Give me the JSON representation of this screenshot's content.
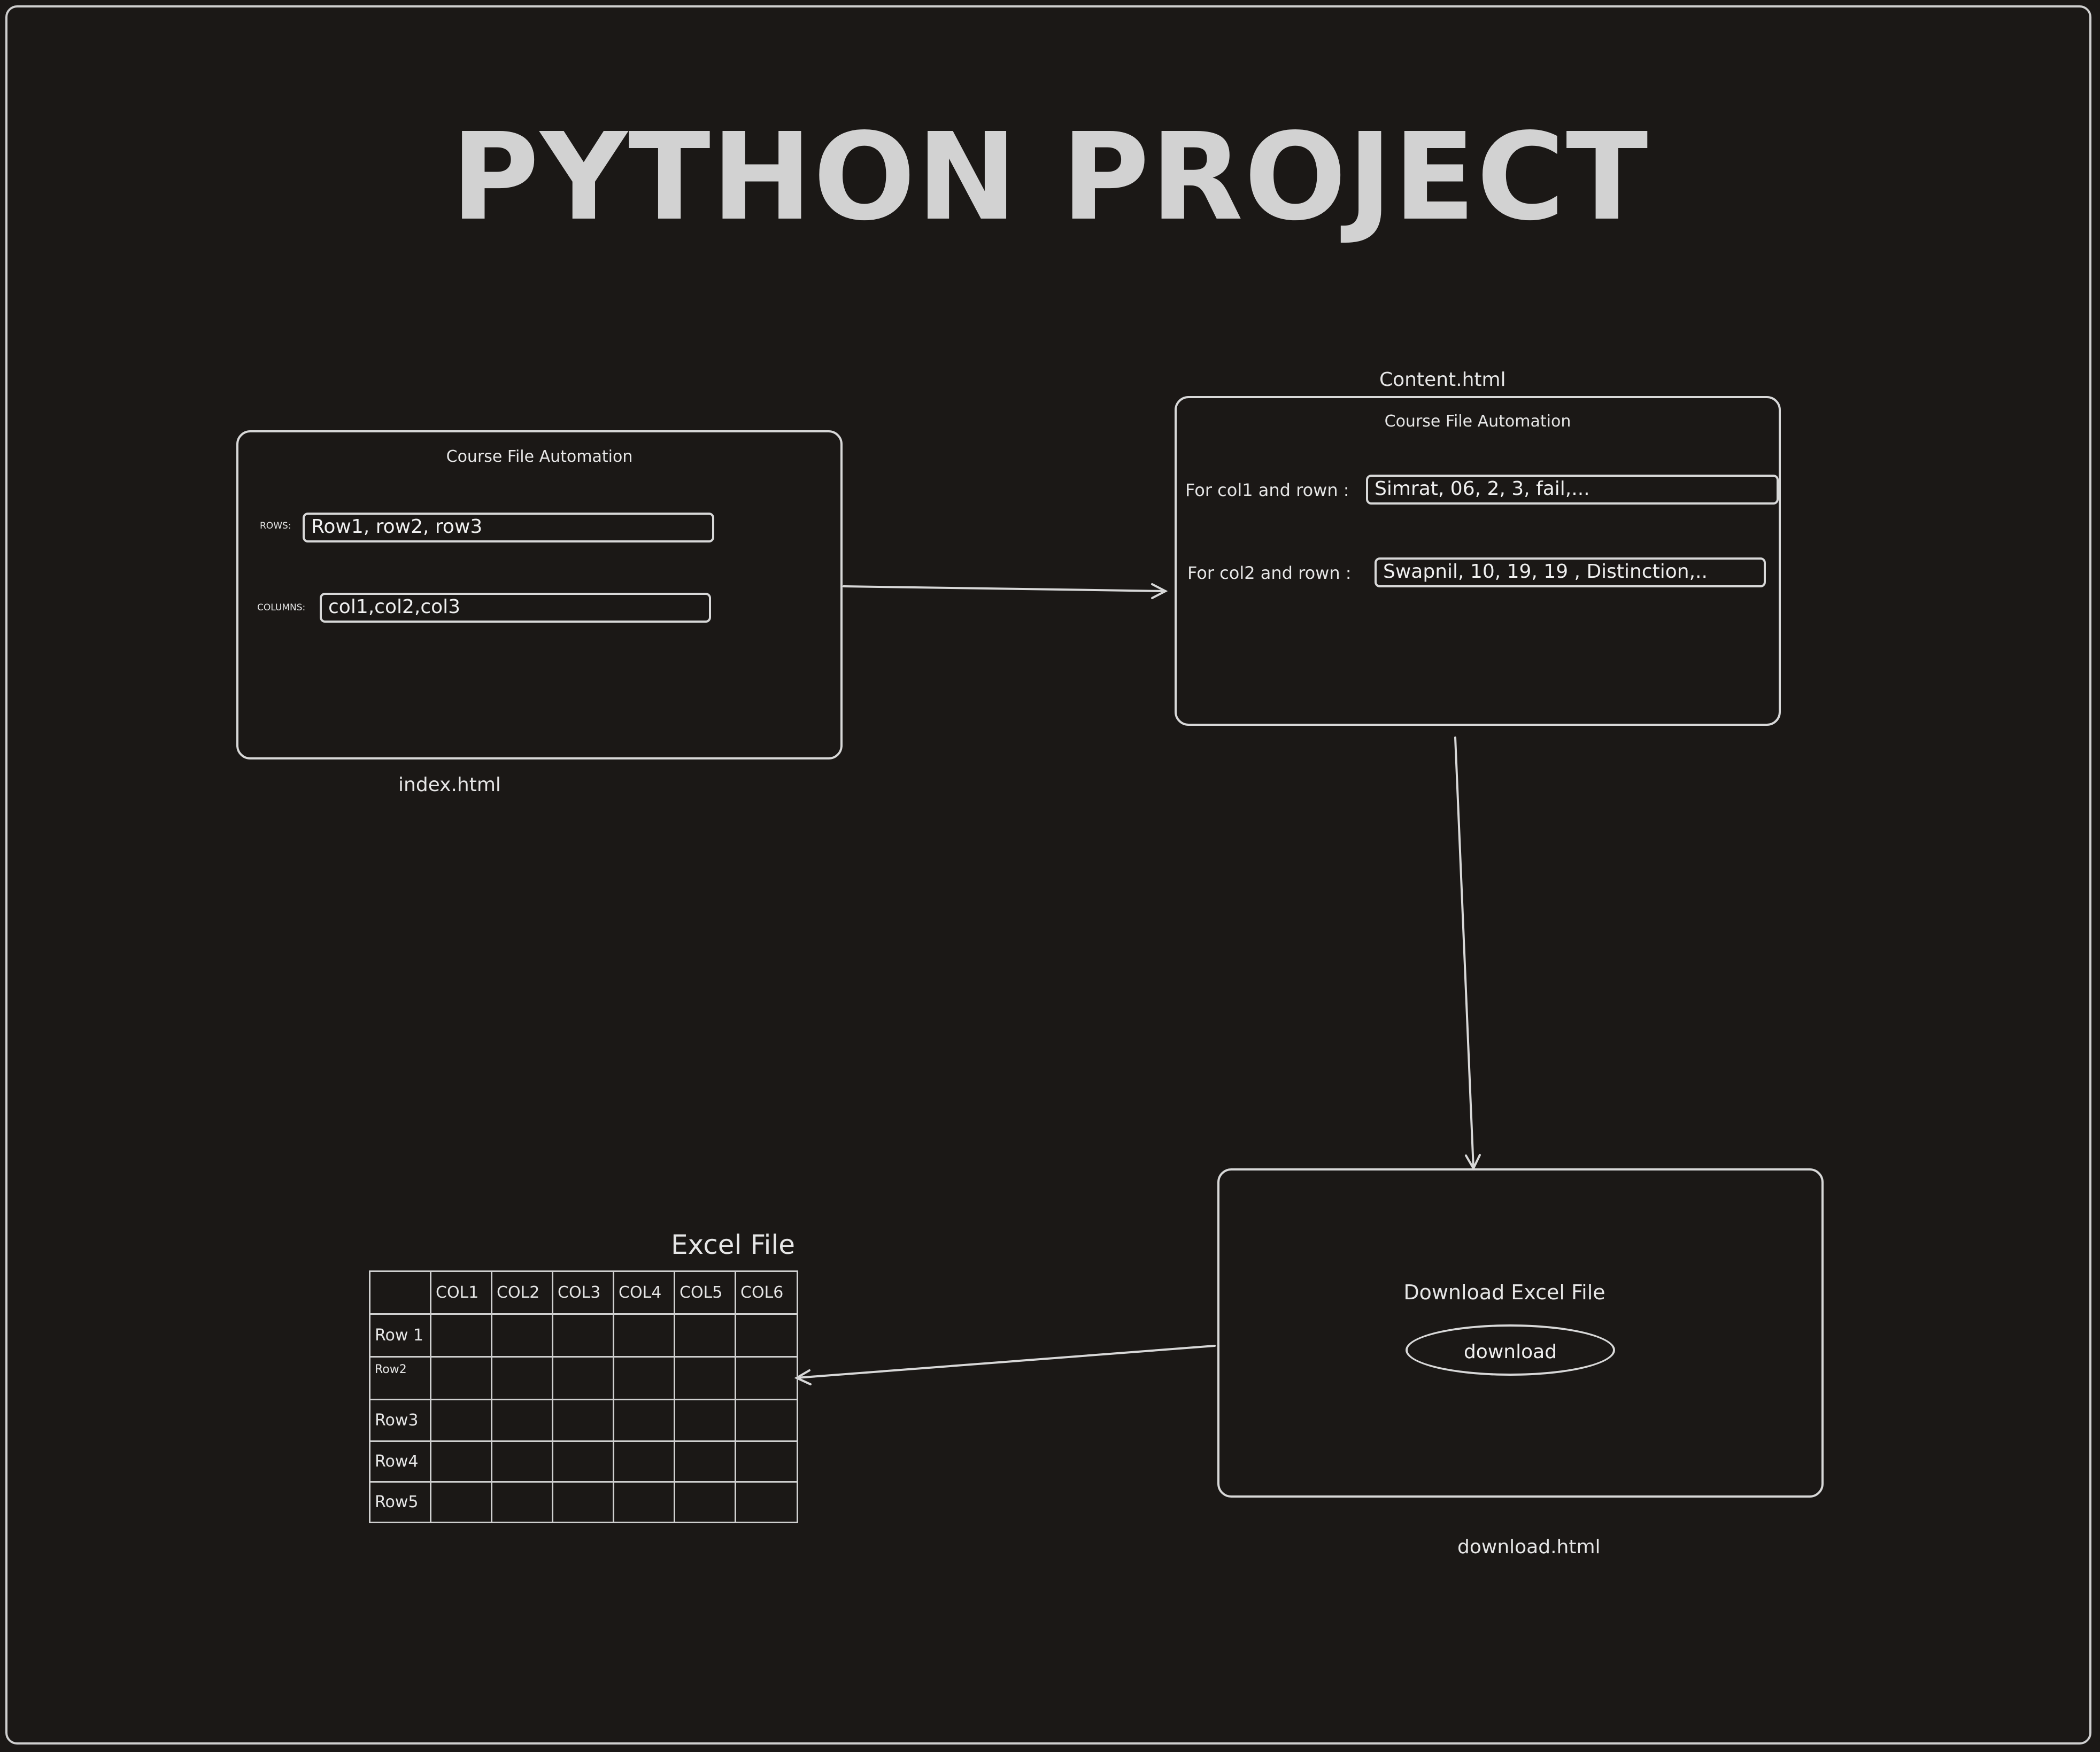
{
  "title": "PYTHON PROJECT",
  "index_page": {
    "caption": "index.html",
    "heading": "Course File Automation",
    "rows_label": "ROWS:",
    "rows_value": "Row1, row2, row3",
    "columns_label": "COLUMNS:",
    "columns_value": "col1,col2,col3"
  },
  "content_page": {
    "caption": "Content.html",
    "heading": "Course File Automation",
    "field1_label": "For col1 and rown :",
    "field1_value": "Simrat, 06, 2, 3, fail,...",
    "field2_label": "For col2 and rown :",
    "field2_value": "Swapnil, 10, 19, 19 , Distinction,.."
  },
  "download_page": {
    "caption": "download.html",
    "heading": "Download Excel File",
    "button_label": "download"
  },
  "excel": {
    "title": "Excel File",
    "columns": [
      "",
      "COL1",
      "COL2",
      "COL3",
      "COL4",
      "COL5",
      "COL6"
    ],
    "rows": [
      "Row 1",
      "Row2",
      "Row3",
      "Row4",
      "Row5"
    ]
  },
  "colors": {
    "background": "#1b1816",
    "stroke": "#d8d8d8",
    "title": "#d2d2d2"
  }
}
